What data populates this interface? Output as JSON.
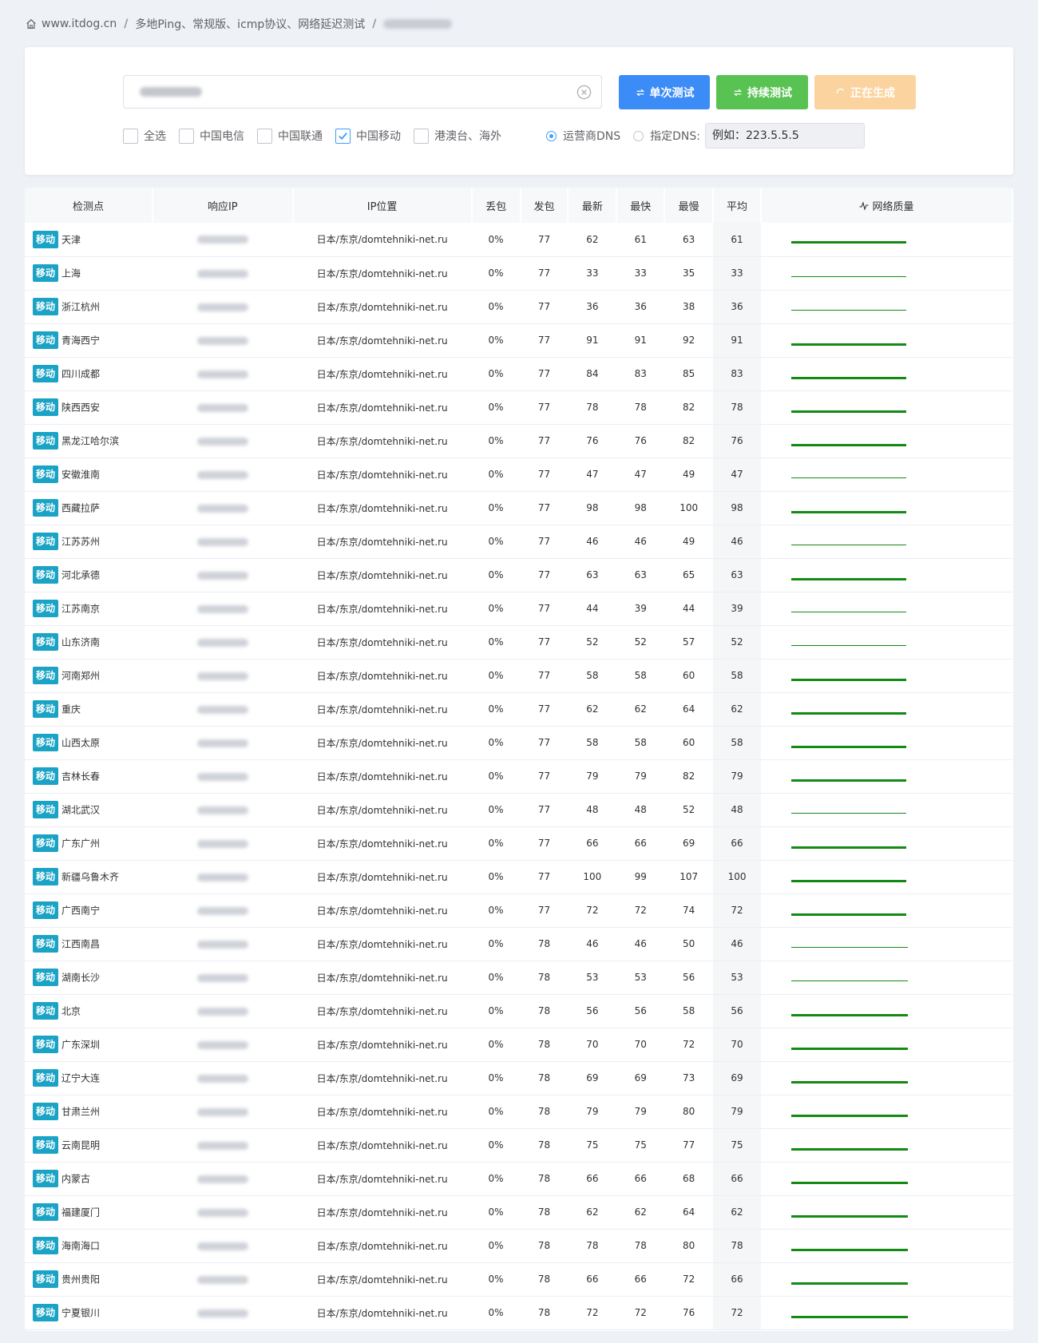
{
  "breadcrumb": {
    "site": "www.itdog.cn",
    "section": "多地Ping、常规版、icmp协议、网络延迟测试"
  },
  "panel": {
    "buttons": {
      "single": "单次测试",
      "continuous": "持续测试",
      "generating": "正在生成"
    },
    "filters": [
      {
        "label": "全选",
        "checked": false
      },
      {
        "label": "中国电信",
        "checked": false
      },
      {
        "label": "中国联通",
        "checked": false
      },
      {
        "label": "中国移动",
        "checked": true
      },
      {
        "label": "港澳台、海外",
        "checked": false
      }
    ],
    "dns": {
      "carrier_label": "运营商DNS",
      "carrier_selected": true,
      "custom_label": "指定DNS:",
      "custom_value": "例如：223.5.5.5"
    }
  },
  "table": {
    "headers": [
      "检测点",
      "响应IP",
      "IP位置",
      "丢包",
      "发包",
      "最新",
      "最快",
      "最慢",
      "平均",
      "网络质量"
    ],
    "tag": "移动",
    "rows": [
      {
        "node": "天津",
        "loc": "日本/东京/domtehniki-net.ru",
        "loss": "0%",
        "sent": "77",
        "latest": "62",
        "fastest": "61",
        "slowest": "63",
        "avg": "61"
      },
      {
        "node": "上海",
        "loc": "日本/东京/domtehniki-net.ru",
        "loss": "0%",
        "sent": "77",
        "latest": "33",
        "fastest": "33",
        "slowest": "35",
        "avg": "33"
      },
      {
        "node": "浙江杭州",
        "loc": "日本/东京/domtehniki-net.ru",
        "loss": "0%",
        "sent": "77",
        "latest": "36",
        "fastest": "36",
        "slowest": "38",
        "avg": "36"
      },
      {
        "node": "青海西宁",
        "loc": "日本/东京/domtehniki-net.ru",
        "loss": "0%",
        "sent": "77",
        "latest": "91",
        "fastest": "91",
        "slowest": "92",
        "avg": "91"
      },
      {
        "node": "四川成都",
        "loc": "日本/东京/domtehniki-net.ru",
        "loss": "0%",
        "sent": "77",
        "latest": "84",
        "fastest": "83",
        "slowest": "85",
        "avg": "83"
      },
      {
        "node": "陕西西安",
        "loc": "日本/东京/domtehniki-net.ru",
        "loss": "0%",
        "sent": "77",
        "latest": "78",
        "fastest": "78",
        "slowest": "82",
        "avg": "78"
      },
      {
        "node": "黑龙江哈尔滨",
        "loc": "日本/东京/domtehniki-net.ru",
        "loss": "0%",
        "sent": "77",
        "latest": "76",
        "fastest": "76",
        "slowest": "82",
        "avg": "76"
      },
      {
        "node": "安徽淮南",
        "loc": "日本/东京/domtehniki-net.ru",
        "loss": "0%",
        "sent": "77",
        "latest": "47",
        "fastest": "47",
        "slowest": "49",
        "avg": "47"
      },
      {
        "node": "西藏拉萨",
        "loc": "日本/东京/domtehniki-net.ru",
        "loss": "0%",
        "sent": "77",
        "latest": "98",
        "fastest": "98",
        "slowest": "100",
        "avg": "98"
      },
      {
        "node": "江苏苏州",
        "loc": "日本/东京/domtehniki-net.ru",
        "loss": "0%",
        "sent": "77",
        "latest": "46",
        "fastest": "46",
        "slowest": "49",
        "avg": "46"
      },
      {
        "node": "河北承德",
        "loc": "日本/东京/domtehniki-net.ru",
        "loss": "0%",
        "sent": "77",
        "latest": "63",
        "fastest": "63",
        "slowest": "65",
        "avg": "63"
      },
      {
        "node": "江苏南京",
        "loc": "日本/东京/domtehniki-net.ru",
        "loss": "0%",
        "sent": "77",
        "latest": "44",
        "fastest": "39",
        "slowest": "44",
        "avg": "39"
      },
      {
        "node": "山东济南",
        "loc": "日本/东京/domtehniki-net.ru",
        "loss": "0%",
        "sent": "77",
        "latest": "52",
        "fastest": "52",
        "slowest": "57",
        "avg": "52"
      },
      {
        "node": "河南郑州",
        "loc": "日本/东京/domtehniki-net.ru",
        "loss": "0%",
        "sent": "77",
        "latest": "58",
        "fastest": "58",
        "slowest": "60",
        "avg": "58"
      },
      {
        "node": "重庆",
        "loc": "日本/东京/domtehniki-net.ru",
        "loss": "0%",
        "sent": "77",
        "latest": "62",
        "fastest": "62",
        "slowest": "64",
        "avg": "62"
      },
      {
        "node": "山西太原",
        "loc": "日本/东京/domtehniki-net.ru",
        "loss": "0%",
        "sent": "77",
        "latest": "58",
        "fastest": "58",
        "slowest": "60",
        "avg": "58"
      },
      {
        "node": "吉林长春",
        "loc": "日本/东京/domtehniki-net.ru",
        "loss": "0%",
        "sent": "77",
        "latest": "79",
        "fastest": "79",
        "slowest": "82",
        "avg": "79"
      },
      {
        "node": "湖北武汉",
        "loc": "日本/东京/domtehniki-net.ru",
        "loss": "0%",
        "sent": "77",
        "latest": "48",
        "fastest": "48",
        "slowest": "52",
        "avg": "48"
      },
      {
        "node": "广东广州",
        "loc": "日本/东京/domtehniki-net.ru",
        "loss": "0%",
        "sent": "77",
        "latest": "66",
        "fastest": "66",
        "slowest": "69",
        "avg": "66"
      },
      {
        "node": "新疆乌鲁木齐",
        "loc": "日本/东京/domtehniki-net.ru",
        "loss": "0%",
        "sent": "77",
        "latest": "100",
        "fastest": "99",
        "slowest": "107",
        "avg": "100"
      },
      {
        "node": "广西南宁",
        "loc": "日本/东京/domtehniki-net.ru",
        "loss": "0%",
        "sent": "77",
        "latest": "72",
        "fastest": "72",
        "slowest": "74",
        "avg": "72"
      },
      {
        "node": "江西南昌",
        "loc": "日本/东京/domtehniki-net.ru",
        "loss": "0%",
        "sent": "78",
        "latest": "46",
        "fastest": "46",
        "slowest": "50",
        "avg": "46"
      },
      {
        "node": "湖南长沙",
        "loc": "日本/东京/domtehniki-net.ru",
        "loss": "0%",
        "sent": "78",
        "latest": "53",
        "fastest": "53",
        "slowest": "56",
        "avg": "53"
      },
      {
        "node": "北京",
        "loc": "日本/东京/domtehniki-net.ru",
        "loss": "0%",
        "sent": "78",
        "latest": "56",
        "fastest": "56",
        "slowest": "58",
        "avg": "56"
      },
      {
        "node": "广东深圳",
        "loc": "日本/东京/domtehniki-net.ru",
        "loss": "0%",
        "sent": "78",
        "latest": "70",
        "fastest": "70",
        "slowest": "72",
        "avg": "70"
      },
      {
        "node": "辽宁大连",
        "loc": "日本/东京/domtehniki-net.ru",
        "loss": "0%",
        "sent": "78",
        "latest": "69",
        "fastest": "69",
        "slowest": "73",
        "avg": "69"
      },
      {
        "node": "甘肃兰州",
        "loc": "日本/东京/domtehniki-net.ru",
        "loss": "0%",
        "sent": "78",
        "latest": "79",
        "fastest": "79",
        "slowest": "80",
        "avg": "79"
      },
      {
        "node": "云南昆明",
        "loc": "日本/东京/domtehniki-net.ru",
        "loss": "0%",
        "sent": "78",
        "latest": "75",
        "fastest": "75",
        "slowest": "77",
        "avg": "75"
      },
      {
        "node": "内蒙古",
        "loc": "日本/东京/domtehniki-net.ru",
        "loss": "0%",
        "sent": "78",
        "latest": "66",
        "fastest": "66",
        "slowest": "68",
        "avg": "66"
      },
      {
        "node": "福建厦门",
        "loc": "日本/东京/domtehniki-net.ru",
        "loss": "0%",
        "sent": "78",
        "latest": "62",
        "fastest": "62",
        "slowest": "64",
        "avg": "62"
      },
      {
        "node": "海南海口",
        "loc": "日本/东京/domtehniki-net.ru",
        "loss": "0%",
        "sent": "78",
        "latest": "78",
        "fastest": "78",
        "slowest": "80",
        "avg": "78"
      },
      {
        "node": "贵州贵阳",
        "loc": "日本/东京/domtehniki-net.ru",
        "loss": "0%",
        "sent": "78",
        "latest": "66",
        "fastest": "66",
        "slowest": "72",
        "avg": "66"
      },
      {
        "node": "宁夏银川",
        "loc": "日本/东京/domtehniki-net.ru",
        "loss": "0%",
        "sent": "78",
        "latest": "72",
        "fastest": "72",
        "slowest": "76",
        "avg": "72"
      }
    ]
  },
  "colors": {
    "primary": "#3b8cf6",
    "success": "#58c252",
    "warning_light": "#fbd39e",
    "tag": "#1aa3c5",
    "quality_line": "#138a14"
  }
}
